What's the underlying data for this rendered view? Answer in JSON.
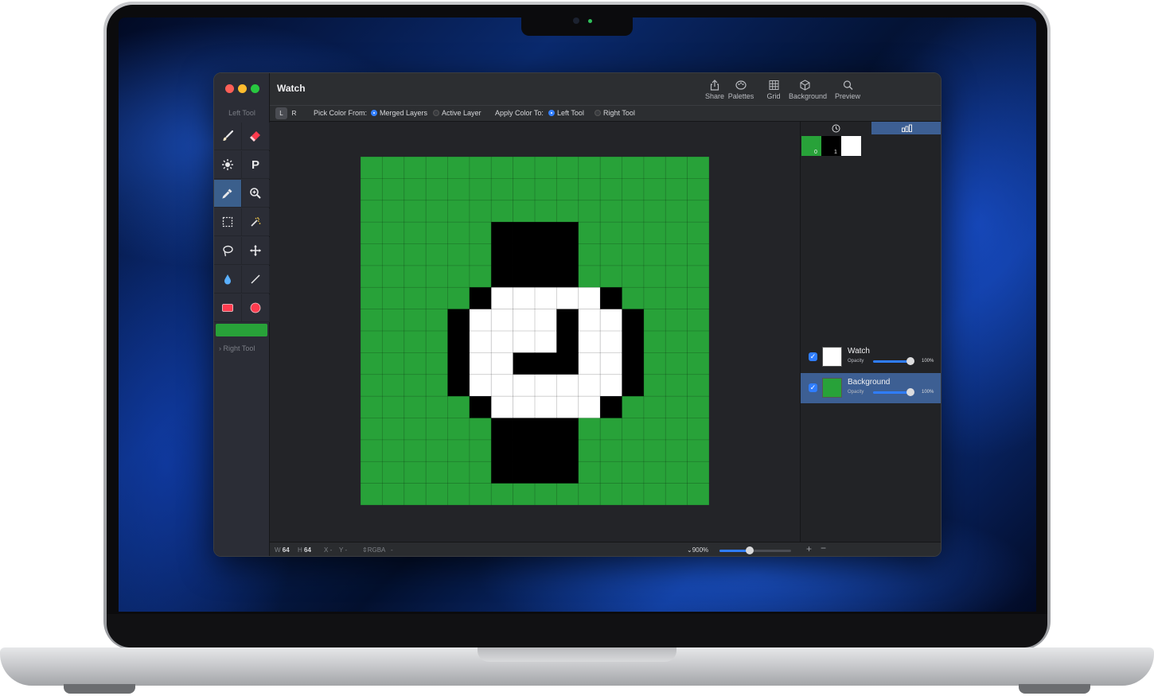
{
  "window": {
    "title": "Watch",
    "toolbar": [
      {
        "label": "Share",
        "icon": "share-icon"
      },
      {
        "label": "Palettes",
        "icon": "palette-icon"
      },
      {
        "label": "Grid",
        "icon": "grid-icon"
      },
      {
        "label": "Background",
        "icon": "cube-icon"
      },
      {
        "label": "Preview",
        "icon": "magnifier-icon"
      }
    ]
  },
  "sidebar": {
    "left_tool_label": "Left Tool",
    "right_tool_label": "Right Tool",
    "current_color": "#28a239",
    "tools": [
      {
        "name": "brush",
        "icon": "brush-icon",
        "active": false
      },
      {
        "name": "eraser",
        "icon": "eraser-icon",
        "active": false
      },
      {
        "name": "lighten",
        "icon": "sun-icon",
        "active": false
      },
      {
        "name": "pattern",
        "icon": "letter-p-icon",
        "glyph": "P",
        "active": false
      },
      {
        "name": "eyedropper",
        "icon": "eyedropper-icon",
        "active": true
      },
      {
        "name": "zoom",
        "icon": "zoom-icon",
        "active": false
      },
      {
        "name": "rect-select",
        "icon": "marquee-icon",
        "active": false
      },
      {
        "name": "magic-wand",
        "icon": "magic-wand-icon",
        "active": false
      },
      {
        "name": "lasso",
        "icon": "lasso-icon",
        "active": false
      },
      {
        "name": "move",
        "icon": "move-icon",
        "active": false
      },
      {
        "name": "fill",
        "icon": "drop-icon",
        "active": false
      },
      {
        "name": "line",
        "icon": "line-icon",
        "active": false
      },
      {
        "name": "rectangle",
        "icon": "rectangle-icon",
        "active": false
      },
      {
        "name": "ellipse",
        "icon": "circle-icon",
        "active": false
      }
    ]
  },
  "options": {
    "seg_left": "L",
    "seg_right": "R",
    "pick_from_label": "Pick Color From:",
    "pick_from": [
      "Merged Layers",
      "Active Layer"
    ],
    "pick_from_selected": "Merged Layers",
    "apply_to_label": "Apply Color To:",
    "apply_to": [
      "Left Tool",
      "Right Tool"
    ],
    "apply_to_selected": "Left Tool"
  },
  "canvas": {
    "grid_size": 16,
    "colors": {
      "g": "#28a239",
      "k": "#000000",
      "w": "#ffffff"
    },
    "rows": [
      "gggggggggggggggg",
      "gggggggggggggggg",
      "gggggggggggggggg",
      "ggggggkkkkgggggg",
      "ggggggkkkkgggggg",
      "ggggggkkkkgggggg",
      "gggggkwwwwwkgggg",
      "ggggkwwwwkwwkggg",
      "ggggkwwwwkwwkggg",
      "ggggkwwkkkwwkggg",
      "ggggkwwwwwwwkggg",
      "gggggkwwwwwkgggg",
      "ggggggkkkkgggggg",
      "ggggggkkkkgggggg",
      "ggggggkkkkgggggg",
      "gggggggggggggggg"
    ]
  },
  "status": {
    "w_label": "W",
    "w": "64",
    "h_label": "H",
    "h": "64",
    "x_label": "X",
    "x": "-",
    "y_label": "Y",
    "y": "-",
    "color_mode": "RGBA",
    "color_value": "-",
    "zoom": "900%",
    "zoom_fraction": 0.42
  },
  "frames": [
    {
      "index": "0",
      "color": "#28a239"
    },
    {
      "index": "1",
      "color": "#000000"
    },
    {
      "index": "",
      "color": "#ffffff"
    }
  ],
  "layers": [
    {
      "name": "Watch",
      "opacity_label": "Opacity",
      "opacity": "100%",
      "visible": true,
      "selected": false,
      "thumb": "#ffffff"
    },
    {
      "name": "Background",
      "opacity_label": "Opacity",
      "opacity": "100%",
      "visible": true,
      "selected": true,
      "thumb": "#28a239"
    }
  ]
}
